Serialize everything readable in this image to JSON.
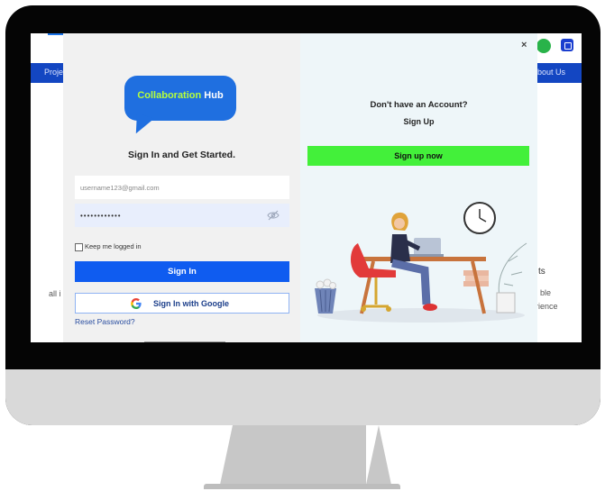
{
  "background_page": {
    "nav_left": "Proje",
    "nav_right": "bout Us",
    "text_left": "all i",
    "text_right_1": "ts",
    "text_right_2": "ble",
    "text_right_3": "rience"
  },
  "login": {
    "logo_part1": "Collaboration",
    "logo_part2": "Hub",
    "title": "Sign In and Get Started.",
    "email_value": "username123@gmail.com",
    "password_value": "••••••••••••",
    "keep_logged_in": "Keep me logged in",
    "signin_button": "Sign In",
    "google_button": "Sign In with Google",
    "reset_password": "Reset Password?"
  },
  "signup": {
    "close": "×",
    "prompt": "Don't have an Account?",
    "link": "Sign Up",
    "button": "Sign up now"
  },
  "colors": {
    "primary_blue": "#0f5cf0",
    "signup_green": "#43f03a",
    "logo_green": "#b6ff3b",
    "nav_blue": "#1346c2"
  },
  "icons": [
    "eye-slash-icon",
    "google-icon",
    "close-icon",
    "checkbox-icon"
  ]
}
